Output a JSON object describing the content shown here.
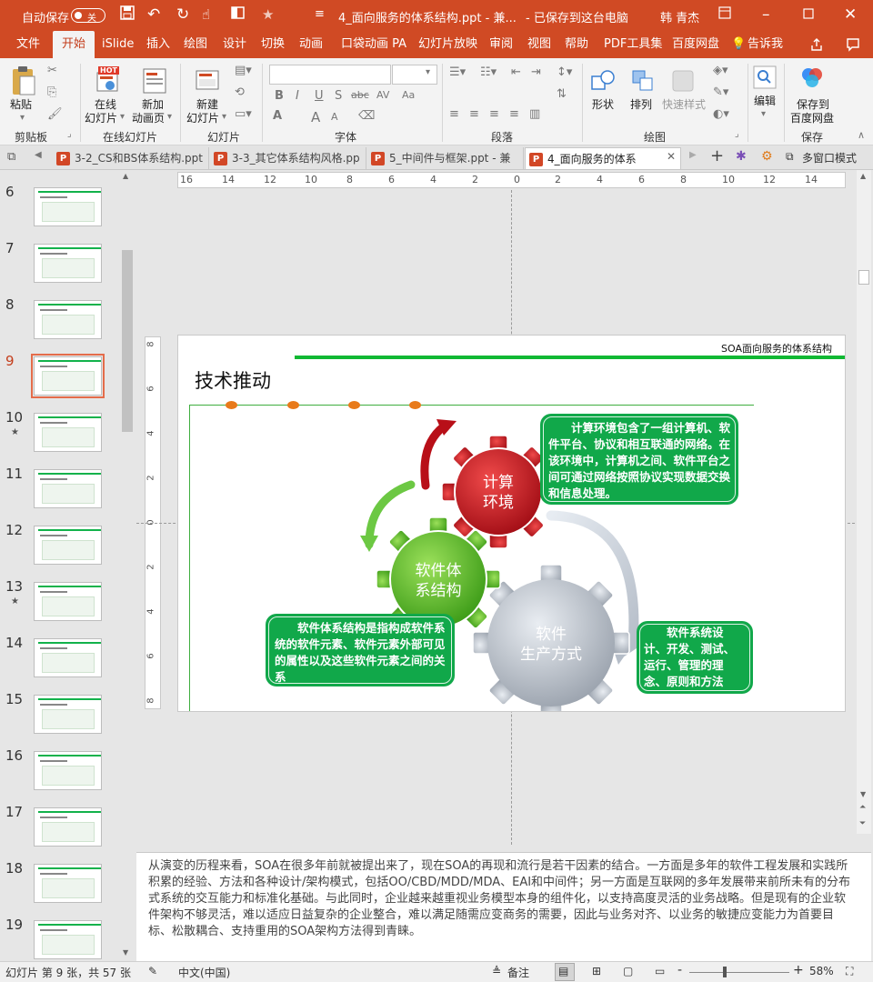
{
  "titlebar": {
    "autosave_label": "自动保存",
    "autosave_state": "关",
    "doc_title": "4_面向服务的体系结构.ppt  -  兼...",
    "save_status": "-  已保存到这台电脑",
    "user": "韩 青杰"
  },
  "menu": {
    "tabs": [
      "文件",
      "开始",
      "iSlide",
      "插入",
      "绘图",
      "设计",
      "切换",
      "动画",
      "口袋动画 PA",
      "幻灯片放映",
      "审阅",
      "视图",
      "帮助",
      "PDF工具集",
      "百度网盘"
    ],
    "active": "开始",
    "tell_me": "告诉我"
  },
  "ribbon": {
    "clipboard": {
      "paste": "粘贴",
      "group": "剪贴板"
    },
    "online": {
      "online_slide": [
        "在线",
        "幻灯片"
      ],
      "new_anim_page": [
        "新加",
        "动画页"
      ],
      "group": "在线幻灯片",
      "hot": "HOT"
    },
    "slides": {
      "new_slide": [
        "新建",
        "幻灯片"
      ],
      "group": "幻灯片"
    },
    "font": {
      "group": "字体",
      "bold": "B",
      "italic": "I",
      "underline": "U",
      "strike": "S",
      "abc": "abc",
      "av": "AV",
      "aa": "Aa",
      "a_big": "A",
      "a_small": "A"
    },
    "paragraph": {
      "group": "段落"
    },
    "drawing": {
      "shape": "形状",
      "arrange": "排列",
      "quick_style": "快速样式",
      "group": "绘图"
    },
    "edit": {
      "edit": "编辑"
    },
    "save": {
      "save_baidu": [
        "保存到",
        "百度网盘"
      ],
      "group": "保存"
    }
  },
  "doctabs": {
    "tabs": [
      "3-2_CS和BS体系结构.ppt",
      "3-3_其它体系结构风格.pp",
      "5_中间件与框架.ppt - 兼",
      "4_面向服务的体系"
    ],
    "active_index": 3,
    "multi_window": "多窗口模式",
    "plus": "+"
  },
  "thumbnails": [
    {
      "num": "6",
      "star": ""
    },
    {
      "num": "7",
      "star": ""
    },
    {
      "num": "8",
      "star": ""
    },
    {
      "num": "9",
      "star": "",
      "selected": true
    },
    {
      "num": "10",
      "star": "★"
    },
    {
      "num": "11",
      "star": ""
    },
    {
      "num": "12",
      "star": ""
    },
    {
      "num": "13",
      "star": "★"
    },
    {
      "num": "14",
      "star": ""
    },
    {
      "num": "15",
      "star": ""
    },
    {
      "num": "16",
      "star": ""
    },
    {
      "num": "17",
      "star": ""
    },
    {
      "num": "18",
      "star": ""
    },
    {
      "num": "19",
      "star": ""
    }
  ],
  "ruler": {
    "h_labels": [
      "16",
      "14",
      "12",
      "10",
      "8",
      "6",
      "4",
      "2",
      "0",
      "2",
      "4",
      "6",
      "8",
      "10",
      "12",
      "14",
      "16"
    ],
    "v_labels": [
      "8",
      "6",
      "4",
      "2",
      "0",
      "2",
      "4",
      "6",
      "8"
    ]
  },
  "slide": {
    "header_tag": "SOA面向服务的体系结构",
    "title": "技术推动",
    "gear_red": [
      "计算",
      "环境"
    ],
    "gear_green": [
      "软件体",
      "系结构"
    ],
    "gear_gray": [
      "软件",
      "生产方式"
    ],
    "callout_top": "　　计算环境包含了一组计算机、软件平台、协议和相互联通的网络。在该环境中，计算机之间、软件平台之间可通过网络按照协议实现数据交换和信息处理。",
    "callout_left": "　　软件体系结构是指构成软件系统的软件元素、软件元素外部可见的属性以及这些软件元素之间的关系",
    "callout_right": "　　软件系统设计、开发、测试、运行、管理的理念、原则和方法",
    "colors": {
      "green": "#11a84a",
      "red": "#c8141c",
      "accent": "#d04a24"
    }
  },
  "notes": {
    "text": "从演变的历程来看，SOA在很多年前就被提出来了，现在SOA的再现和流行是若干因素的结合。一方面是多年的软件工程发展和实践所积累的经验、方法和各种设计/架构模式，包括OO/CBD/MDD/MDA、EAI和中间件；另一方面是互联网的多年发展带来前所未有的分布式系统的交互能力和标准化基础。与此同时，企业越来越重视业务模型本身的组件化，以支持高度灵活的业务战略。但是现有的企业软件架构不够灵活，难以适应日益复杂的企业整合，难以满足随需应变商务的需要，因此与业务对齐、以业务的敏捷应变能力为首要目标、松散耦合、支持重用的SOA架构方法得到青睐。"
  },
  "status": {
    "slide_info": "幻灯片 第 9 张，共 57 张",
    "language": "中文(中国)",
    "notes_btn": "备注",
    "zoom": "58%",
    "minus": "-",
    "plus": "+"
  }
}
